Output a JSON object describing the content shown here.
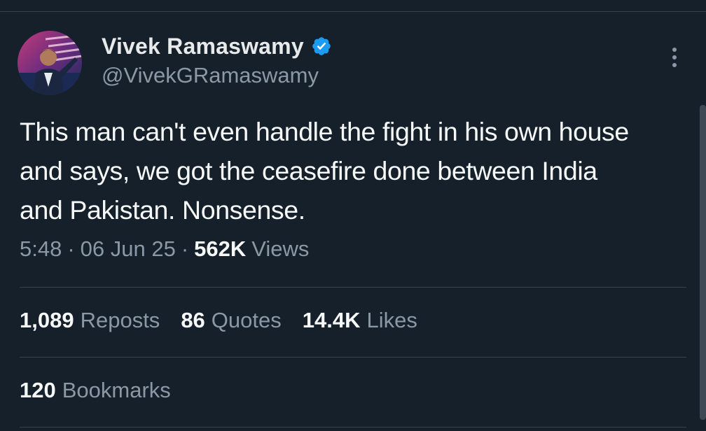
{
  "tweet": {
    "author": {
      "display_name": "Vivek Ramaswamy",
      "handle": "@VivekGRamaswamy",
      "verified": true,
      "verified_color": "#1d9bf0"
    },
    "text_lines": [
      "This man can't even handle the fight in his own house",
      "and says, we got the ceasefire done between India",
      "and Pakistan. Nonsense."
    ],
    "meta": {
      "time": "5:48",
      "separator": "·",
      "date": "06 Jun 25",
      "views_count": "562K",
      "views_label": "Views"
    },
    "stats": {
      "reposts": {
        "count": "1,089",
        "label": "Reposts"
      },
      "quotes": {
        "count": "86",
        "label": "Quotes"
      },
      "likes": {
        "count": "14.4K",
        "label": "Likes"
      },
      "bookmarks": {
        "count": "120",
        "label": "Bookmarks"
      }
    }
  },
  "icons": {
    "more": "more-vertical-icon",
    "verified": "verified-badge-icon"
  },
  "colors": {
    "background": "#15202b",
    "text_primary": "#f7f9f9",
    "text_secondary": "#8b98a5",
    "divider": "#38444d"
  }
}
